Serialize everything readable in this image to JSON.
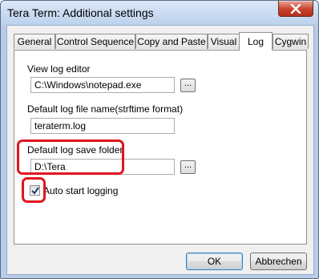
{
  "window": {
    "title": "Tera Term: Additional settings"
  },
  "tabs": [
    {
      "label": "General"
    },
    {
      "label": "Control Sequence"
    },
    {
      "label": "Copy and Paste"
    },
    {
      "label": "Visual"
    },
    {
      "label": "Log",
      "active": true
    },
    {
      "label": "Cygwin"
    }
  ],
  "log": {
    "view_editor_label": "View log editor",
    "view_editor_value": "C:\\Windows\\notepad.exe",
    "default_filename_label": "Default log file name(strftime format)",
    "default_filename_value": "teraterm.log",
    "save_folder_label": "Default log save folder",
    "save_folder_value": "D:\\Tera",
    "auto_start_label": "Auto start logging",
    "auto_start_checked": true,
    "browse_label": "..."
  },
  "footer": {
    "ok_label": "OK",
    "cancel_label": "Abbrechen"
  },
  "colors": {
    "highlight": "#e0151f",
    "close_button": "#c8422d"
  }
}
